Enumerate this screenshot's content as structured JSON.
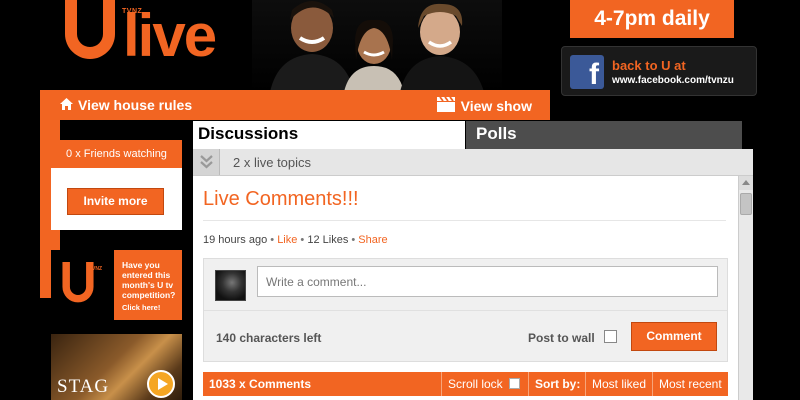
{
  "header": {
    "logo_text": "live",
    "logo_badge": "TVNZ",
    "time_badge": "4-7pm daily",
    "facebook": {
      "icon": "facebook-icon",
      "line1": "back to U at",
      "line2": "www.facebook.com/tvnzu"
    }
  },
  "nav": {
    "house_rules": "View house rules",
    "view_show": "View show",
    "house_icon": "home-icon",
    "show_icon": "clapperboard-icon"
  },
  "sidebar": {
    "friends_watching": "0 x Friends watching",
    "invite_button": "Invite more",
    "competition_ad": {
      "badge": "TVNZ",
      "text": "Have you entered this month's U tv competition?",
      "link": "Click here!"
    },
    "stag_ad": {
      "label": "STAG",
      "icon": "play-icon"
    }
  },
  "tabs": {
    "discussions": "Discussions",
    "polls": "Polls"
  },
  "topics": {
    "label": "2 x live topics",
    "icon": "chevron-down-icon"
  },
  "post": {
    "title": "Live Comments!!!",
    "age": "19 hours ago",
    "like": "Like",
    "likes": "12 Likes",
    "share": "Share"
  },
  "comment_form": {
    "placeholder": "Write a comment...",
    "chars_left": "140 characters left",
    "post_to_wall": "Post to wall",
    "submit": "Comment"
  },
  "comments_bar": {
    "count": "1033 x Comments",
    "scroll_lock": "Scroll lock",
    "sort_by": "Sort by:",
    "most_liked": "Most liked",
    "most_recent": "Most recent"
  },
  "colors": {
    "accent": "#f26522",
    "background": "#000000",
    "facebook": "#3b5998"
  }
}
